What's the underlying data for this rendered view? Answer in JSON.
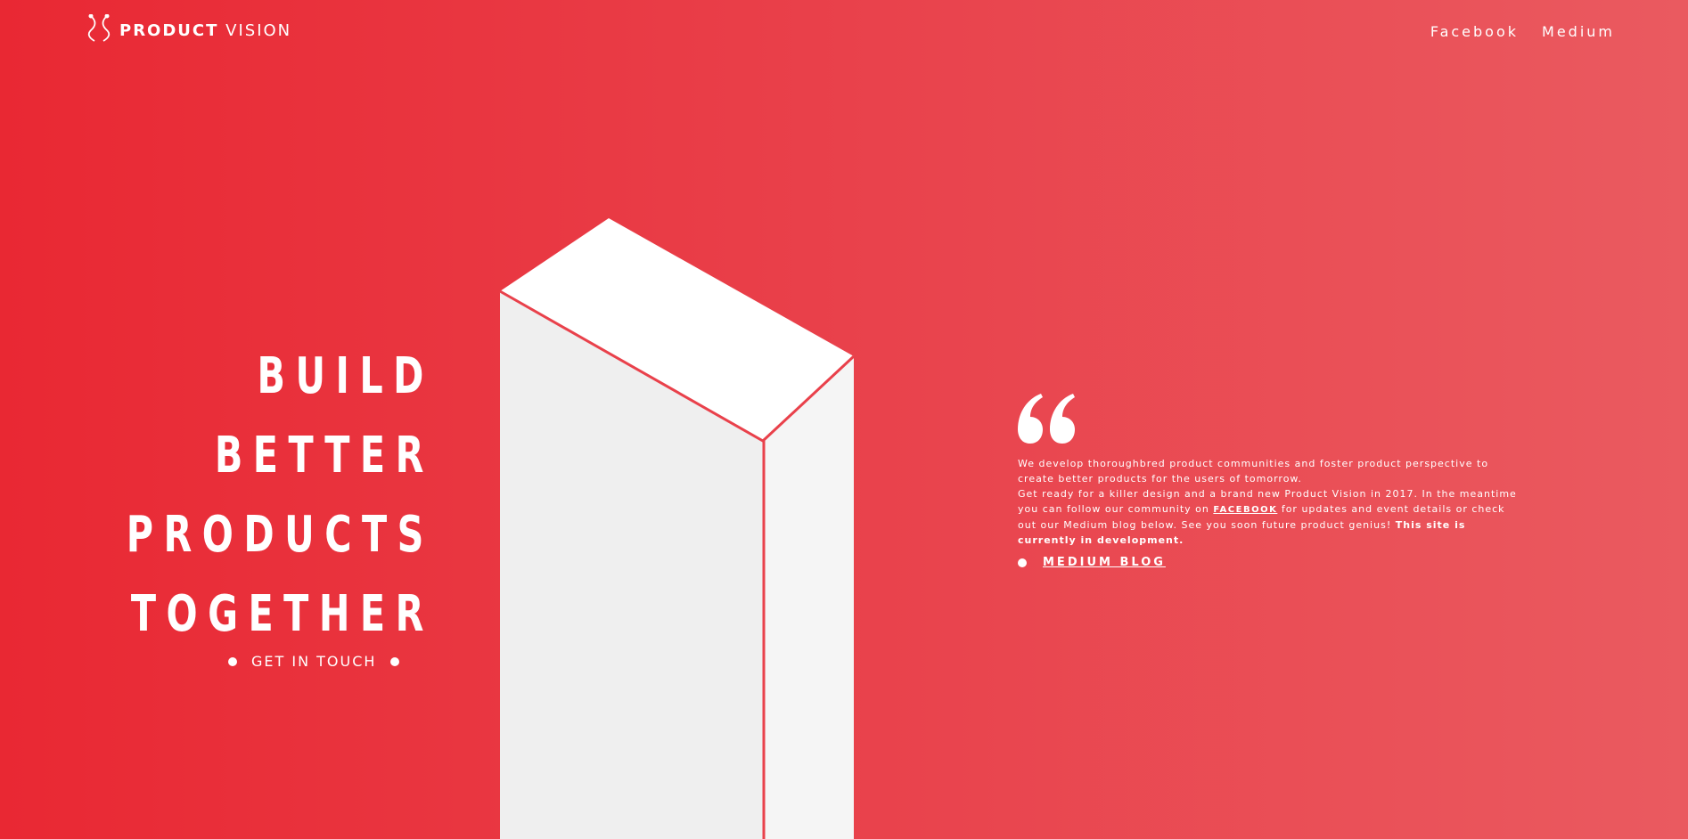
{
  "brand": {
    "name_bold": "PRODUCT",
    "name_light": "VISION",
    "icon": "product-vision-logo-icon"
  },
  "nav": {
    "items": [
      "Facebook",
      "Medium"
    ]
  },
  "hero": {
    "headline": [
      "BUILD",
      "BETTER",
      "PRODUCTS",
      "TOGETHER"
    ],
    "cta_label": "GET IN TOUCH"
  },
  "about": {
    "quote_icon": "quote-icon",
    "line1": "We develop thoroughbred product communities and foster product perspective to create better products for the users of tomorrow.",
    "line2_start": "Get ready for a killer design and a brand new Product Vision in 2017. In the meantime you can follow our community on",
    "facebook_link": "FACEBOOK",
    "line2_end": "for updates and event details or check out our Medium blog below. See you soon future product genius!",
    "line2_bold": "This site is currently in development.",
    "medium_link": "MEDIUM BLOG"
  },
  "colors": {
    "accent": "#e92833",
    "white": "#ffffff",
    "tower_left": "#efefef",
    "tower_right": "#f5f5f5"
  }
}
